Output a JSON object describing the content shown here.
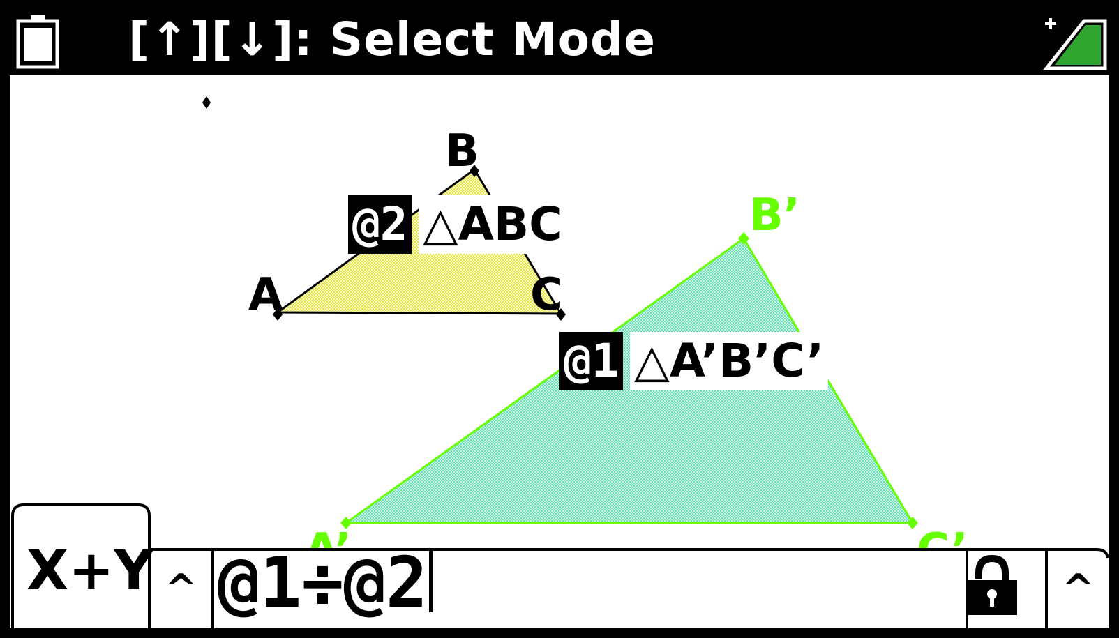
{
  "status_bar": {
    "title": "[↑][↓]: Select Mode",
    "battery_icon": "battery-icon",
    "signal_icon": "signal-icon"
  },
  "colors": {
    "frame": "#000000",
    "triangle_small_fill": "#f0f07a",
    "triangle_large_fill": "#9be8c8",
    "triangle_large_stroke": "#66ff00",
    "label_green": "#66ff00"
  },
  "geometry": {
    "small_triangle": {
      "vertices": [
        "A",
        "B",
        "C"
      ],
      "tag": "@2",
      "name": "△ABC"
    },
    "large_triangle": {
      "vertices": [
        "A’",
        "B’",
        "C’"
      ],
      "tag": "@1",
      "name": "△A’B’C’"
    }
  },
  "toolbar": {
    "mode_tab_label": "X+Y",
    "expand_left": "^",
    "expression": "@1÷@2",
    "lock_icon": "unlocked-padlock-icon",
    "expand_right": "^"
  }
}
